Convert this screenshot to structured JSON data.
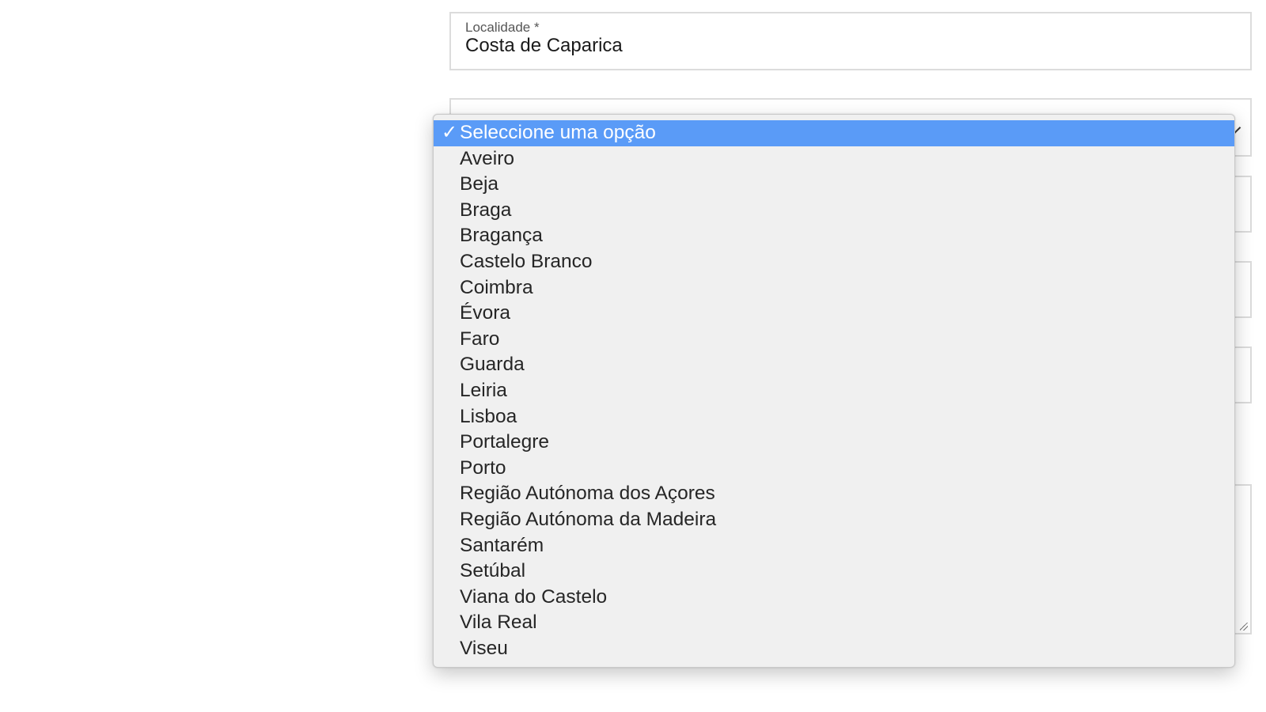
{
  "localidade": {
    "label": "Localidade *",
    "value": "Costa de Caparica"
  },
  "distrito_select": {
    "selected": "Seleccione uma opção",
    "options": [
      "Seleccione uma opção",
      "Aveiro",
      "Beja",
      "Braga",
      "Bragança",
      "Castelo Branco",
      "Coimbra",
      "Évora",
      "Faro",
      "Guarda",
      "Leiria",
      "Lisboa",
      "Portalegre",
      "Porto",
      "Região Autónoma dos Açores",
      "Região Autónoma da Madeira",
      "Santarém",
      "Setúbal",
      "Viana do Castelo",
      "Vila Real",
      "Viseu"
    ],
    "check_glyph": "✓",
    "highlight_color": "#5a9bf7"
  }
}
